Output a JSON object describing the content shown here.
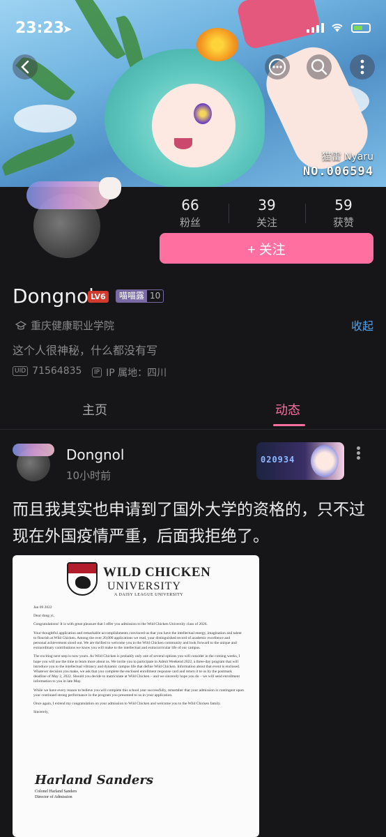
{
  "status_bar": {
    "time": "23:23"
  },
  "banner": {
    "badge_name": "猫雷 Nyaru",
    "badge_no": "NO.006594"
  },
  "profile": {
    "stats": [
      {
        "num": "66",
        "label": "粉丝"
      },
      {
        "num": "39",
        "label": "关注"
      },
      {
        "num": "59",
        "label": "获赞"
      }
    ],
    "follow_label": "+ 关注",
    "username": "Dongnol",
    "level": "LV6",
    "fan_badge_name": "喵喵露",
    "fan_badge_level": "10",
    "school": "重庆健康职业学院",
    "collapse": "收起",
    "bio": "这个人很神秘，什么都没有写",
    "uid": "71564835",
    "ip": "IP 属地：四川"
  },
  "tabs": {
    "home": "主页",
    "dynamic": "动态"
  },
  "post": {
    "author": "Dongnol",
    "time": "10小时前",
    "decor_number": "020934",
    "text": "而且我其实也申请到了国外大学的资格的，只不过现在外国疫情严重，后面我拒绝了。",
    "letter": {
      "title": "WILD CHICKEN",
      "subtitle": "UNIVERSITY",
      "tagline": "A DAISY LEAGUE UNIVERSITY",
      "date": "Jan 09 2022",
      "salutation": "Dear dong yi,",
      "paragraphs": [
        "Congratulations! It is with great pleasure that I offer you admission to the Wild Chicken University class of 2026.",
        "Your thoughtful application and remarkable accomplishments convinced us that you have the intellectual energy, imagination and talent to flourish at Wild Chicken. Among the over 20,000 applications we read, your distinguished record of academic excellence and personal achievement stood out. We are thrilled to welcome you to the Wild Chicken community and look forward to the unique and extraordinary contributions we know you will make to the intellectual and extracurricular life of our campus.",
        "The exciting next step is now yours. As Wild Chicken is probably only one of several options you will consider in the coming weeks, I hope you will use the time to learn more about us. We invite you to participate in Admit Weekend 2022, a three-day program that will introduce you to the intellectual vibrancy and dynamic campus life that define Wild Chicken. Information about that event is enclosed. Whatever decision you make, we ask that you complete the enclosed enrollment response card and return it to us by the postmark deadline of May 2, 2022. Should you decide to matriculate at Wild Chicken – and we sincerely hope you do – we will send enrollment information to you in late May.",
        "While we have every reason to believe you will complete this school year successfully, remember that your admission is contingent upon your continued strong performance in the program you presented to us in your application.",
        "Once again, I extend my congratulation on your admission to Wild Chicken and welcome you to the Wild Chicken family.",
        "Sincerely,"
      ],
      "signature": "Harland Sanders",
      "signer": "Colonel Harland Sanders",
      "role": "Director of Admission"
    }
  }
}
